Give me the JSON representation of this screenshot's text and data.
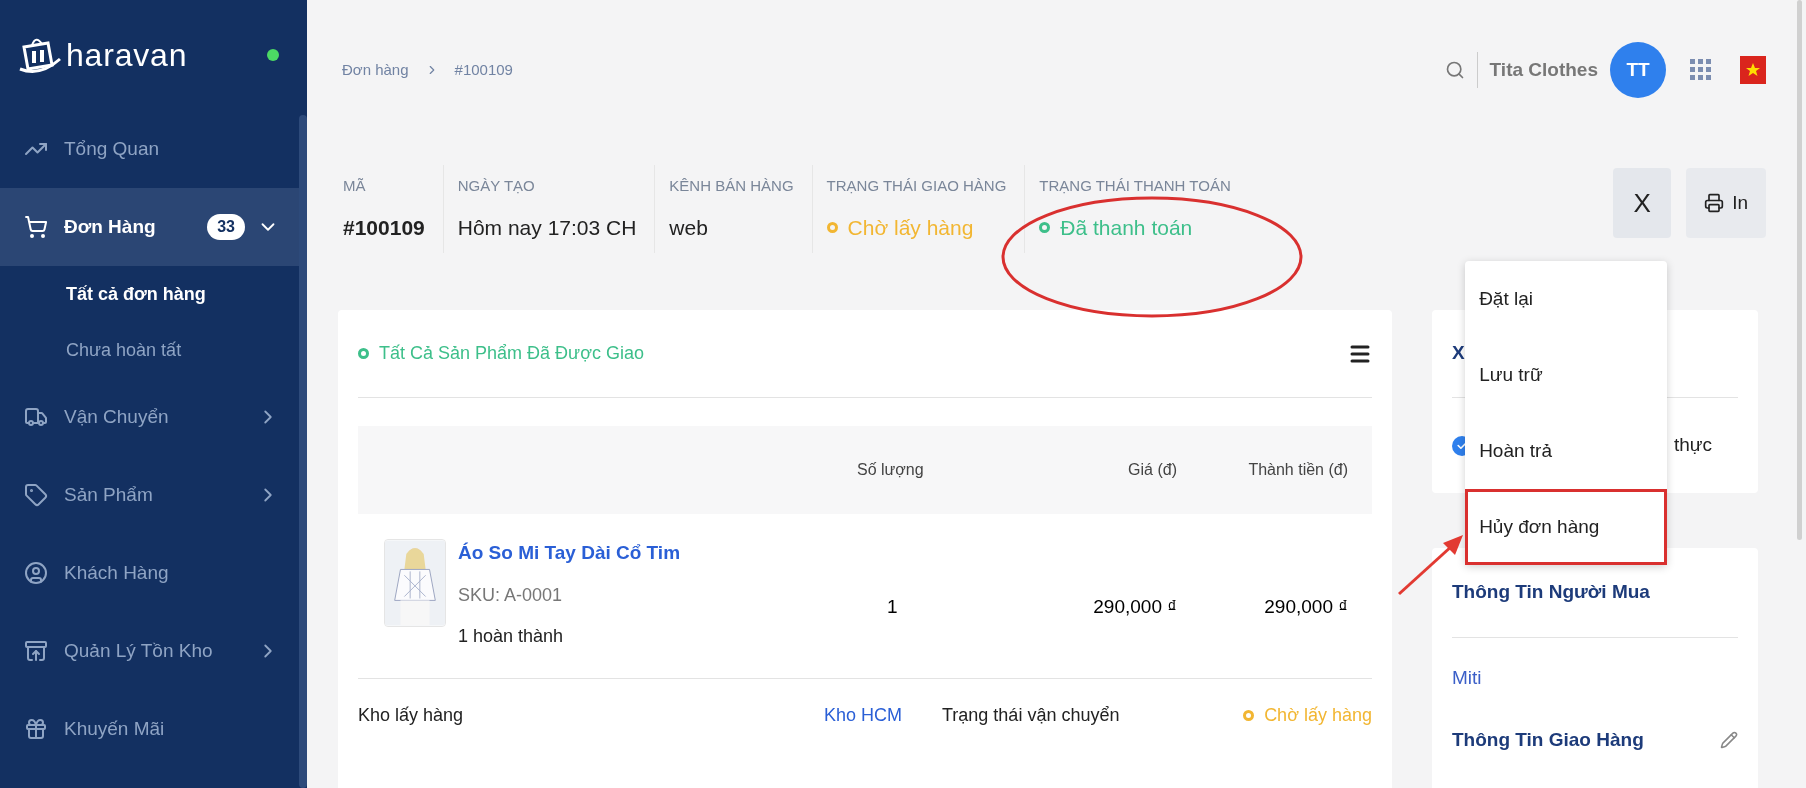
{
  "sidebar": {
    "logo": "haravan",
    "online": true,
    "items": [
      {
        "label": "Tổng Quan",
        "kind": "plain",
        "selected": false
      },
      {
        "label": "Đơn Hàng",
        "kind": "group",
        "selected": true,
        "expanded": true,
        "badge": "33",
        "children": [
          {
            "label": "Tất cả đơn hàng",
            "selected": true
          },
          {
            "label": "Chưa hoàn tất",
            "selected": false
          }
        ]
      },
      {
        "label": "Vận Chuyển",
        "kind": "group",
        "selected": false,
        "expanded": false
      },
      {
        "label": "Sản Phẩm",
        "kind": "group",
        "selected": false,
        "expanded": false
      },
      {
        "label": "Khách Hàng",
        "kind": "plain",
        "selected": false
      },
      {
        "label": "Quản Lý Tồn Kho",
        "kind": "group",
        "selected": false,
        "expanded": false
      },
      {
        "label": "Khuyến Mãi",
        "kind": "plain",
        "selected": false
      }
    ]
  },
  "topbar": {
    "store": "Tita Clothes",
    "avatar": "TT"
  },
  "breadcrumb": [
    "Đơn hàng",
    "#100109"
  ],
  "order_info": [
    {
      "label": "MÃ",
      "value": "#100109",
      "kind": "bold",
      "circled": false
    },
    {
      "label": "NGÀY TẠO",
      "value": "Hôm nay 17:03 CH",
      "kind": "text",
      "circled": false
    },
    {
      "label": "KÊNH BÁN HÀNG",
      "value": "web",
      "kind": "text",
      "circled": false
    },
    {
      "label": "TRẠNG THÁI GIAO HÀNG",
      "value": "Chờ lấy hàng",
      "kind": "status",
      "color": "#f2b632",
      "circled": false
    },
    {
      "label": "TRẠNG THÁI THANH TOÁN",
      "value": "Đã thanh toán",
      "kind": "status",
      "color": "#3dbf8a",
      "circled": true
    }
  ],
  "actions": {
    "close": "X",
    "print": "In",
    "menu_open": true
  },
  "menu": [
    {
      "label": "Đặt lại",
      "highlighted": false
    },
    {
      "label": "Lưu trữ",
      "highlighted": false
    },
    {
      "label": "Hoàn trả",
      "highlighted": false
    },
    {
      "label": "Hủy đơn hàng",
      "highlighted": true
    }
  ],
  "fulfillment": {
    "status": "Tất Cả Sản Phẩm Đã Được Giao",
    "color": "#3dbf8a",
    "columns": [
      "Số lượng",
      "Giá (đ)",
      "Thành tiền (đ)"
    ],
    "rows": [
      {
        "name": "Áo So Mi Tay Dài Cổ Tim",
        "sku": "SKU: A-0001",
        "fulfilled": "1 hoàn thành",
        "quantity": "1",
        "price": "290,000 ₫",
        "total": "290,000 ₫"
      }
    ],
    "warehouse_label": "Kho lấy hàng",
    "warehouse": "Kho HCM",
    "shipping": {
      "label": "Trạng thái vận chuyển",
      "status": "Chờ lấy hàng",
      "color": "#f2b632"
    }
  },
  "confirm_card": {
    "title": "X",
    "verified_text": "thực",
    "verified": true
  },
  "buyer_card": {
    "title": "Thông Tin Người Mua",
    "name": "Miti",
    "shipping_title": "Thông Tin Giao Hàng"
  }
}
